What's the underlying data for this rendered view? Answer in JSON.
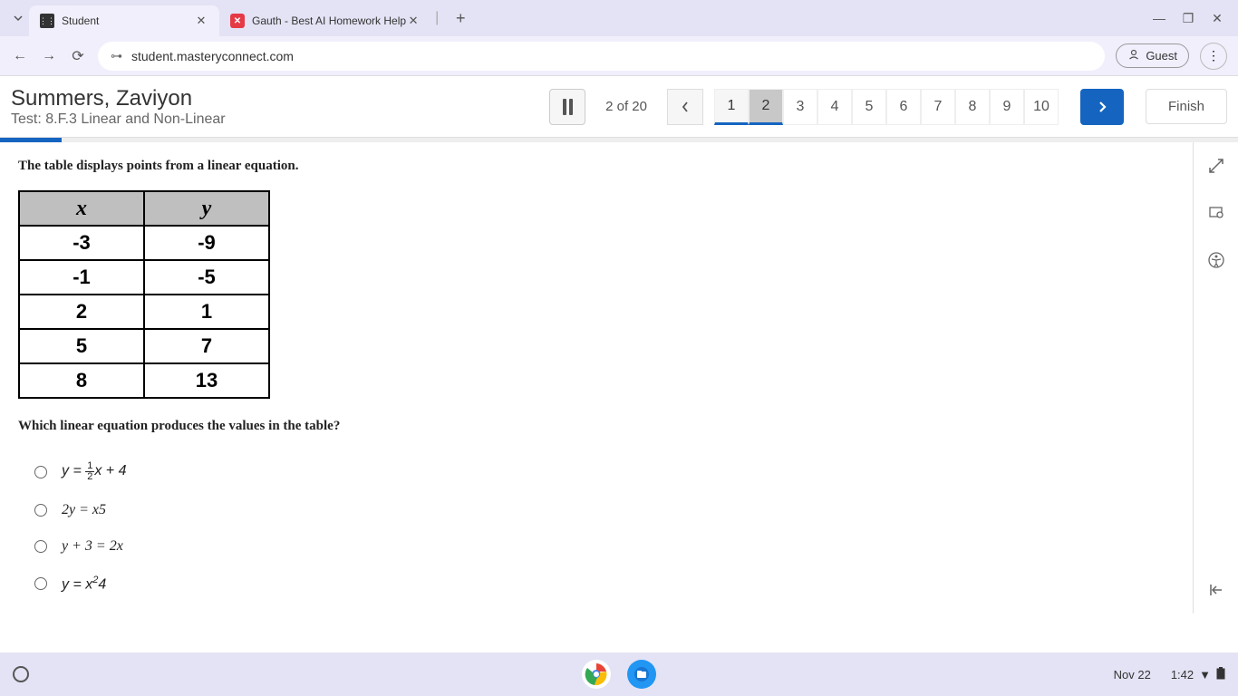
{
  "browser": {
    "tabs": [
      {
        "favicon": "mc",
        "title": "Student"
      },
      {
        "favicon": "gauth",
        "title": "Gauth - Best AI Homework Help"
      }
    ],
    "url": "student.masteryconnect.com",
    "guest": "Guest"
  },
  "header": {
    "student_name": "Summers, Zaviyon",
    "test_name": "Test: 8.F.3 Linear and Non-Linear",
    "progress": "2 of 20",
    "pages": [
      "1",
      "2",
      "3",
      "4",
      "5",
      "6",
      "7",
      "8",
      "9",
      "10"
    ],
    "current_page": 2,
    "finish": "Finish"
  },
  "question": {
    "prompt1": "The table displays points from a linear equation.",
    "table": {
      "headers": [
        "x",
        "y"
      ],
      "rows": [
        [
          "-3",
          "-9"
        ],
        [
          "-1",
          "-5"
        ],
        [
          "2",
          "1"
        ],
        [
          "5",
          "7"
        ],
        [
          "8",
          "13"
        ]
      ]
    },
    "prompt2": "Which linear equation produces the values in the table?",
    "options": {
      "a": {
        "prefix": "y = ",
        "frac_num": "1",
        "frac_den": "2",
        "suffix": "x + 4"
      },
      "b": "2y = x5",
      "c": "y + 3 = 2x",
      "d": {
        "prefix": "y = x",
        "sup": "2",
        "suffix": "4"
      }
    }
  },
  "taskbar": {
    "date": "Nov 22",
    "time": "1:42"
  }
}
